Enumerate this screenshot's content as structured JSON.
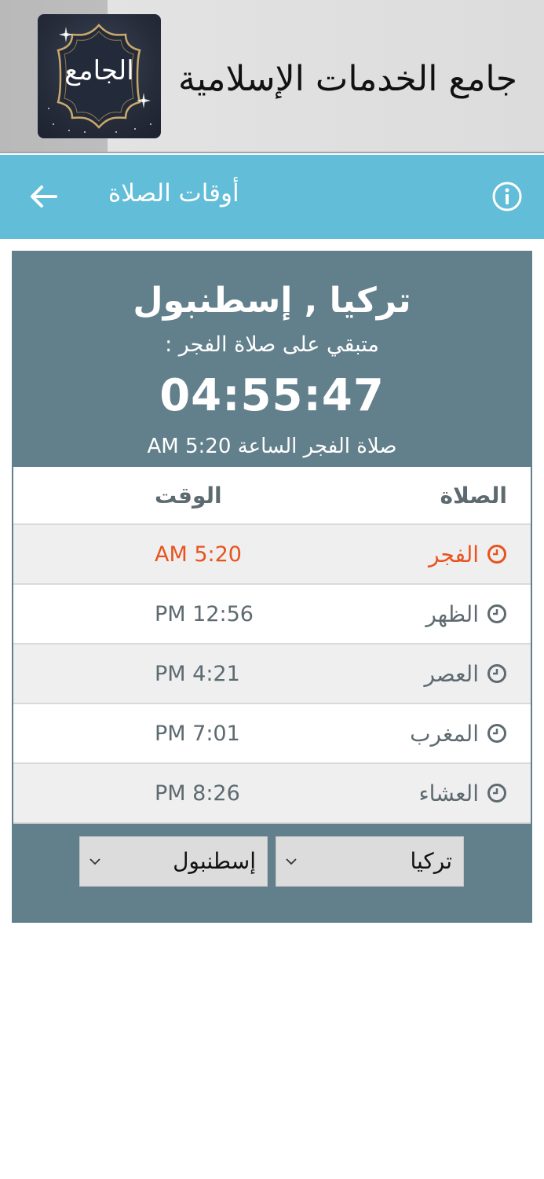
{
  "app": {
    "title": "جامع الخدمات الإسلامية",
    "logo_text": "الجامع"
  },
  "toolbar": {
    "title": "أوقات الصلاة",
    "back_icon": "arrow-left-icon",
    "info_icon": "info-icon"
  },
  "header": {
    "location": "تركيا , إسطنبول",
    "remaining_label": "متبقي على صلاة الفجر :",
    "countdown": "04:55:47",
    "next_prayer": "صلاة الفجر الساعة 5:20 AM"
  },
  "table": {
    "columns": {
      "prayer": "الصلاة",
      "time": "الوقت"
    },
    "rows": [
      {
        "prayer": "الفجر",
        "time": "AM  5:20",
        "active": true
      },
      {
        "prayer": "الظهر",
        "time": "PM  12:56",
        "active": false
      },
      {
        "prayer": "العصر",
        "time": "PM  4:21",
        "active": false
      },
      {
        "prayer": "المغرب",
        "time": "PM  7:01",
        "active": false
      },
      {
        "prayer": "العشاء",
        "time": "PM  8:26",
        "active": false
      }
    ]
  },
  "selects": {
    "country": "تركيا",
    "city": "إسطنبول"
  },
  "colors": {
    "toolbar": "#62bdd8",
    "card": "#627f8c",
    "active": "#e8531f"
  }
}
